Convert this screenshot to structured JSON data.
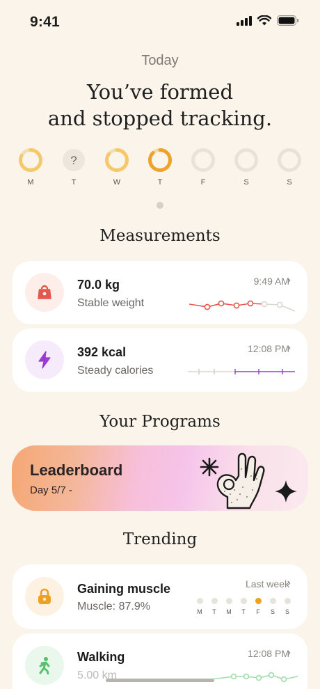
{
  "status": {
    "time": "9:41"
  },
  "header": {
    "today": "Today",
    "headline_line1": "You’ve formed",
    "headline_line2": "and stopped tracking."
  },
  "week": [
    {
      "label": "M",
      "state": "partial"
    },
    {
      "label": "T",
      "state": "unknown",
      "symbol": "?"
    },
    {
      "label": "W",
      "state": "partial"
    },
    {
      "label": "T",
      "state": "today"
    },
    {
      "label": "F",
      "state": "empty"
    },
    {
      "label": "S",
      "state": "empty"
    },
    {
      "label": "S",
      "state": "empty"
    }
  ],
  "sections": {
    "measurements": "Measurements",
    "programs": "Your Programs",
    "trending": "Trending"
  },
  "measurements": [
    {
      "value": "70.0 kg",
      "subtitle": "Stable weight",
      "time": "9:49 AM",
      "icon": "weight-icon",
      "color": "#e2584a"
    },
    {
      "value": "392 kcal",
      "subtitle": "Steady calories",
      "time": "12:08 PM",
      "icon": "lightning-icon",
      "color": "#9a3bd1"
    }
  ],
  "program": {
    "title": "Leaderboard",
    "subtitle": "Day 5/7 -"
  },
  "trending": [
    {
      "title": "Gaining muscle",
      "subtitle": "Muscle: 87.9%",
      "meta": "Last week",
      "icon": "lock-icon",
      "color": "#f0a020",
      "days": [
        "M",
        "T",
        "M",
        "T",
        "F",
        "S",
        "S"
      ],
      "active_day_index": 4
    },
    {
      "title": "Walking",
      "subtitle": "5.00 km",
      "meta": "12:08 PM",
      "icon": "walking-icon",
      "color": "#56c16a"
    }
  ],
  "colors": {
    "background": "#fbf4ea",
    "ring_partial": "#f6c86a",
    "ring_today": "#eda22a",
    "ring_empty": "#e8e2d8"
  }
}
